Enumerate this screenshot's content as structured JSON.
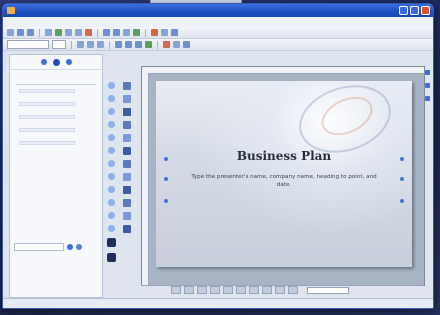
{
  "window": {
    "title": ""
  },
  "menu": {
    "items": [
      "",
      "",
      "",
      "",
      "",
      "",
      "",
      ""
    ]
  },
  "taskpane": {
    "heading": "",
    "links": [
      "",
      "",
      "",
      "",
      ""
    ],
    "search_value": "",
    "footer": "",
    "bottom": ""
  },
  "slide": {
    "title": "Business Plan",
    "subtitle": "Type the presenter's name, company name, heading to point, and date."
  },
  "statusbar": {
    "left": "",
    "middle": ""
  },
  "icons": {
    "app": "presentation-app-icon",
    "nav_back": "back-arrow-icon",
    "nav_home": "home-icon",
    "nav_forward": "forward-arrow-icon",
    "search_go": "go-arrow-icon",
    "help": "help-icon"
  },
  "colors": {
    "titlebar": "#1f4fc0",
    "accent": "#3e6fd8",
    "close_button": "#d9532b"
  }
}
